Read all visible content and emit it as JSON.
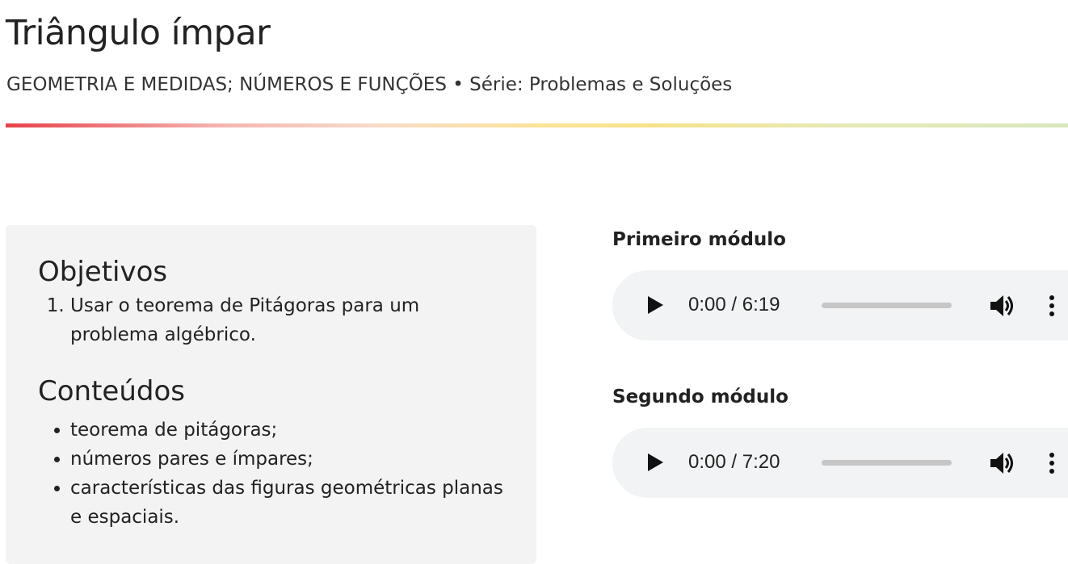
{
  "header": {
    "title": "Triângulo ímpar",
    "subtitle": "GEOMETRIA E MEDIDAS; NÚMEROS E FUNÇÕES • Série: Problemas e Soluções"
  },
  "card": {
    "objectives": {
      "heading": "Objetivos",
      "items": [
        "Usar o teorema de Pitágoras para um problema algébrico."
      ]
    },
    "contents": {
      "heading": "Conteúdos",
      "items": [
        "teorema de pitágoras;",
        "números pares e ímpares;",
        "características das figuras geométricas planas e espaciais."
      ]
    }
  },
  "modules": [
    {
      "label": "Primeiro módulo",
      "time": "0:00 / 6:19",
      "progress": 0
    },
    {
      "label": "Segundo módulo",
      "time": "0:00 / 7:20",
      "progress": 0
    }
  ],
  "icons": {
    "play": "play-icon",
    "volume": "volume-icon",
    "more": "more-vertical-icon"
  },
  "colors": {
    "divider_start": "#e8414a",
    "divider_mid": "#fbe39a",
    "divider_end": "#d8e8bd",
    "card_background": "#f3f3f3",
    "player_background": "#f1f3f4"
  }
}
